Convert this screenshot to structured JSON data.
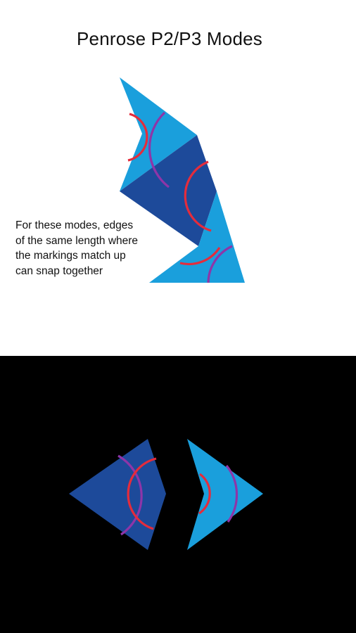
{
  "title": "Penrose P2/P3 Modes",
  "caption_lines": [
    "For these modes, edges",
    "of the same length where",
    "the markings match up",
    "can snap together"
  ],
  "colors": {
    "light_tile": "#1a9fdc",
    "dark_tile": "#1d4a9a",
    "red_marking": "#e42c3c",
    "purple_marking": "#8e35a8",
    "top_background": "#ffffff",
    "bottom_background": "#000000"
  }
}
